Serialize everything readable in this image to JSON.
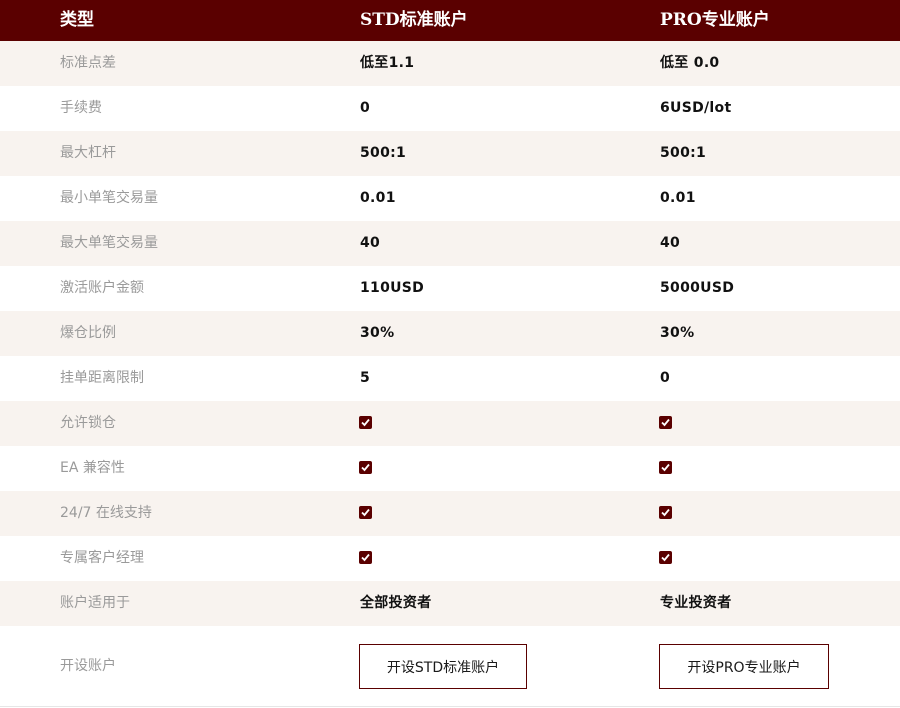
{
  "header": {
    "type_label": "类型",
    "std_label": "STD标准账户",
    "pro_label": "PRO专业账户"
  },
  "rows": [
    {
      "label": "标准点差",
      "std": "低至1.1",
      "pro": "低至 0.0"
    },
    {
      "label": "手续费",
      "std": "0",
      "pro": "6USD/lot"
    },
    {
      "label": "最大杠杆",
      "std": "500:1",
      "pro": "500:1"
    },
    {
      "label": "最小单笔交易量",
      "std": "0.01",
      "pro": "0.01"
    },
    {
      "label": "最大单笔交易量",
      "std": "40",
      "pro": "40"
    },
    {
      "label": "激活账户金额",
      "std": "110USD",
      "pro": "5000USD"
    },
    {
      "label": "爆仓比例",
      "std": "30%",
      "pro": "30%"
    },
    {
      "label": "挂单距离限制",
      "std": "5",
      "pro": "0"
    },
    {
      "label": "允许锁仓",
      "std_check": true,
      "pro_check": true
    },
    {
      "label": "EA 兼容性",
      "std_check": true,
      "pro_check": true
    },
    {
      "label": "24/7 在线支持",
      "std_check": true,
      "pro_check": true
    },
    {
      "label": "专属客户经理",
      "std_check": true,
      "pro_check": true
    },
    {
      "label": "账户适用于",
      "std": "全部投资者",
      "pro": "专业投资者"
    }
  ],
  "open_account": {
    "label": "开设账户",
    "std_button": "开设STD标准账户",
    "pro_button": "开设PRO专业账户"
  },
  "colors": {
    "header_bg": "#5a0000",
    "row_alt_bg": "#f8f3ef",
    "accent": "#5a0000",
    "label_text": "#9a9a9a"
  },
  "icons": {
    "check": "checkbox-checked-icon"
  }
}
